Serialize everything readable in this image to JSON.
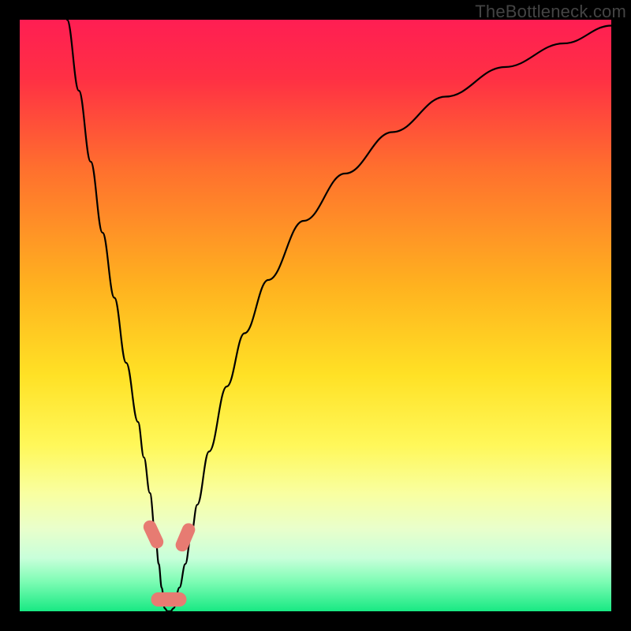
{
  "watermark": "TheBottleneck.com",
  "chart_data": {
    "type": "line",
    "title": "",
    "xlabel": "",
    "ylabel": "",
    "xlim": [
      0,
      100
    ],
    "ylim": [
      0,
      100
    ],
    "background_gradient": {
      "stops": [
        {
          "offset": 0.0,
          "color": "#ff1e53"
        },
        {
          "offset": 0.1,
          "color": "#ff3044"
        },
        {
          "offset": 0.25,
          "color": "#ff6f2e"
        },
        {
          "offset": 0.45,
          "color": "#ffb21f"
        },
        {
          "offset": 0.6,
          "color": "#ffe125"
        },
        {
          "offset": 0.72,
          "color": "#fff85a"
        },
        {
          "offset": 0.8,
          "color": "#f9ffa0"
        },
        {
          "offset": 0.86,
          "color": "#e9ffcb"
        },
        {
          "offset": 0.91,
          "color": "#c8ffda"
        },
        {
          "offset": 0.95,
          "color": "#7dfcb4"
        },
        {
          "offset": 1.0,
          "color": "#18e983"
        }
      ]
    },
    "series": [
      {
        "name": "curve",
        "color": "#000000",
        "width": 2.2,
        "x": [
          8,
          10,
          12,
          14,
          16,
          18,
          20,
          21,
          22,
          23,
          23.5,
          24,
          24.5,
          25,
          25.5,
          26,
          27,
          28,
          29,
          30,
          32,
          35,
          38,
          42,
          48,
          55,
          63,
          72,
          82,
          92,
          100
        ],
        "y": [
          100,
          88,
          76,
          64,
          53,
          42,
          32,
          26,
          20,
          12,
          8,
          4,
          0.5,
          0,
          0,
          0.5,
          4,
          8,
          13,
          18,
          27,
          38,
          47,
          56,
          66,
          74,
          81,
          87,
          92,
          96,
          99
        ]
      }
    ],
    "markers": [
      {
        "name": "marker-left-upper",
        "shape": "pill",
        "x": 22.6,
        "y": 13.0,
        "w": 2.2,
        "h": 5.0,
        "angle": -25,
        "color": "#e77b72"
      },
      {
        "name": "marker-right-upper",
        "shape": "pill",
        "x": 28.0,
        "y": 12.5,
        "w": 2.2,
        "h": 5.0,
        "angle": 23,
        "color": "#e77b72"
      },
      {
        "name": "marker-bottom",
        "shape": "pill",
        "x": 25.2,
        "y": 2.0,
        "w": 6.0,
        "h": 2.4,
        "angle": 0,
        "color": "#e77b72"
      }
    ]
  }
}
